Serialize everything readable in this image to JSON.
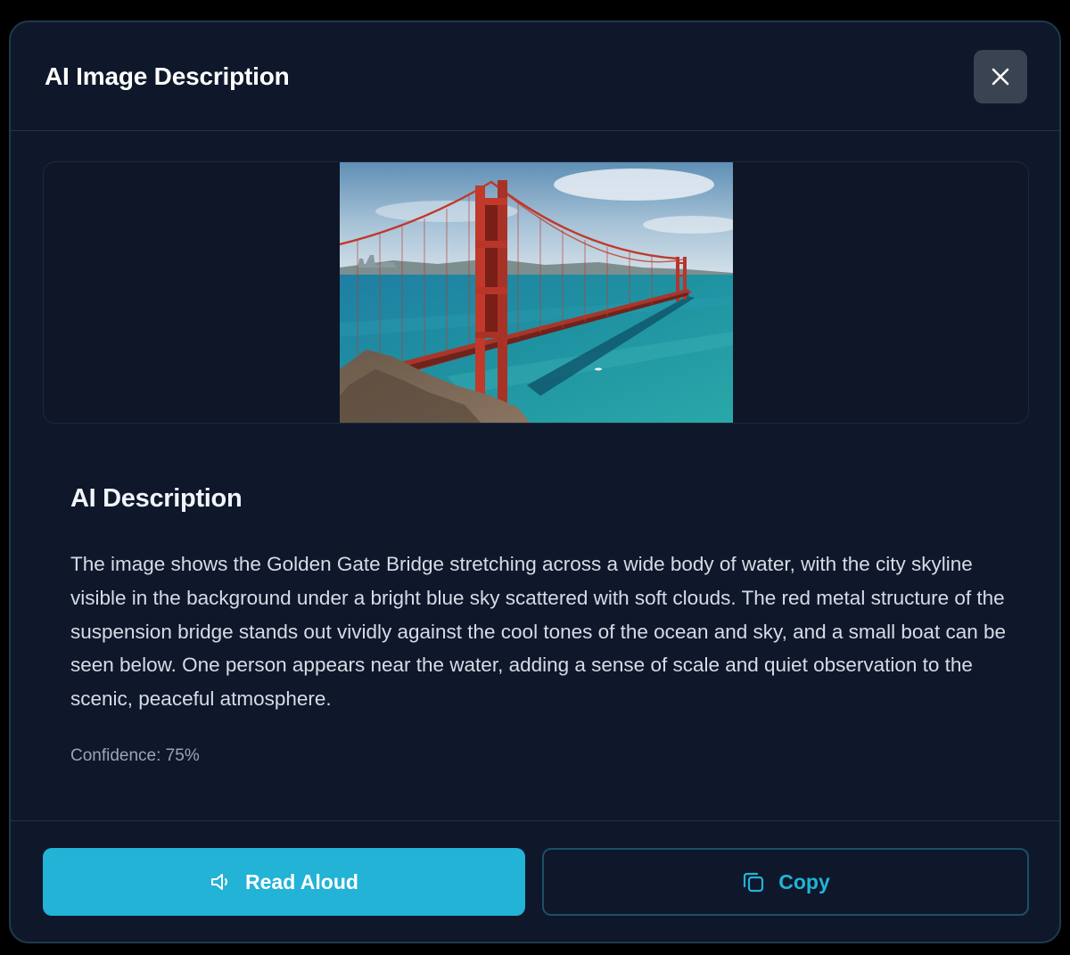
{
  "modal": {
    "title": "AI Image Description",
    "close_icon": "close-icon"
  },
  "image": {
    "alt": "Golden Gate Bridge over the bay"
  },
  "description": {
    "heading": "AI Description",
    "text": "The image shows the Golden Gate Bridge stretching across a wide body of water, with the city skyline visible in the background under a bright blue sky scattered with soft clouds. The red metal structure of the suspension bridge stands out vividly against the cool tones of the ocean and sky, and a small boat can be seen below. One person appears near the water, adding a sense of scale and quiet observation to the scenic, peaceful atmosphere.",
    "confidence": "Confidence: 75%"
  },
  "actions": {
    "read_aloud_label": "Read Aloud",
    "read_aloud_icon": "speaker-icon",
    "copy_label": "Copy",
    "copy_icon": "copy-icon"
  },
  "colors": {
    "background": "#0f172a",
    "accent": "#22b3d6",
    "border": "#1e4f66",
    "close_bg": "#3a4352"
  }
}
